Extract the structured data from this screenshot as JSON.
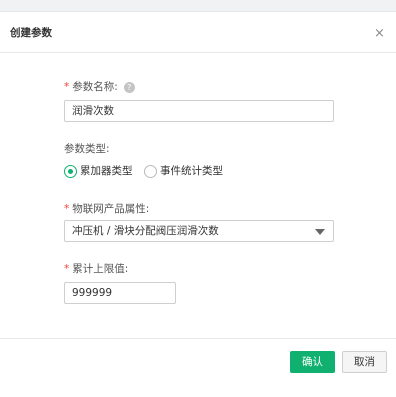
{
  "dialog": {
    "title": "创建参数",
    "close_glyph": "×"
  },
  "form": {
    "param_name": {
      "required_mark": "*",
      "label": "参数名称:",
      "help_glyph": "?",
      "value": "润滑次数"
    },
    "param_type": {
      "label": "参数类型:",
      "options": [
        {
          "label": "累加器类型",
          "selected": true
        },
        {
          "label": "事件统计类型",
          "selected": false
        }
      ]
    },
    "iot_product_attr": {
      "required_mark": "*",
      "label": "物联网产品属性:",
      "selected_value": "冲压机 / 滑块分配阀压润滑次数"
    },
    "cumulative_limit": {
      "required_mark": "*",
      "label": "累计上限值:",
      "value": "999999"
    }
  },
  "footer": {
    "confirm_label": "确认",
    "cancel_label": "取消"
  },
  "colors": {
    "accent": "#10b070",
    "required": "#f04134"
  },
  "icons": {
    "close": "close-icon",
    "help": "help-icon",
    "dropdown": "caret-down-icon"
  }
}
